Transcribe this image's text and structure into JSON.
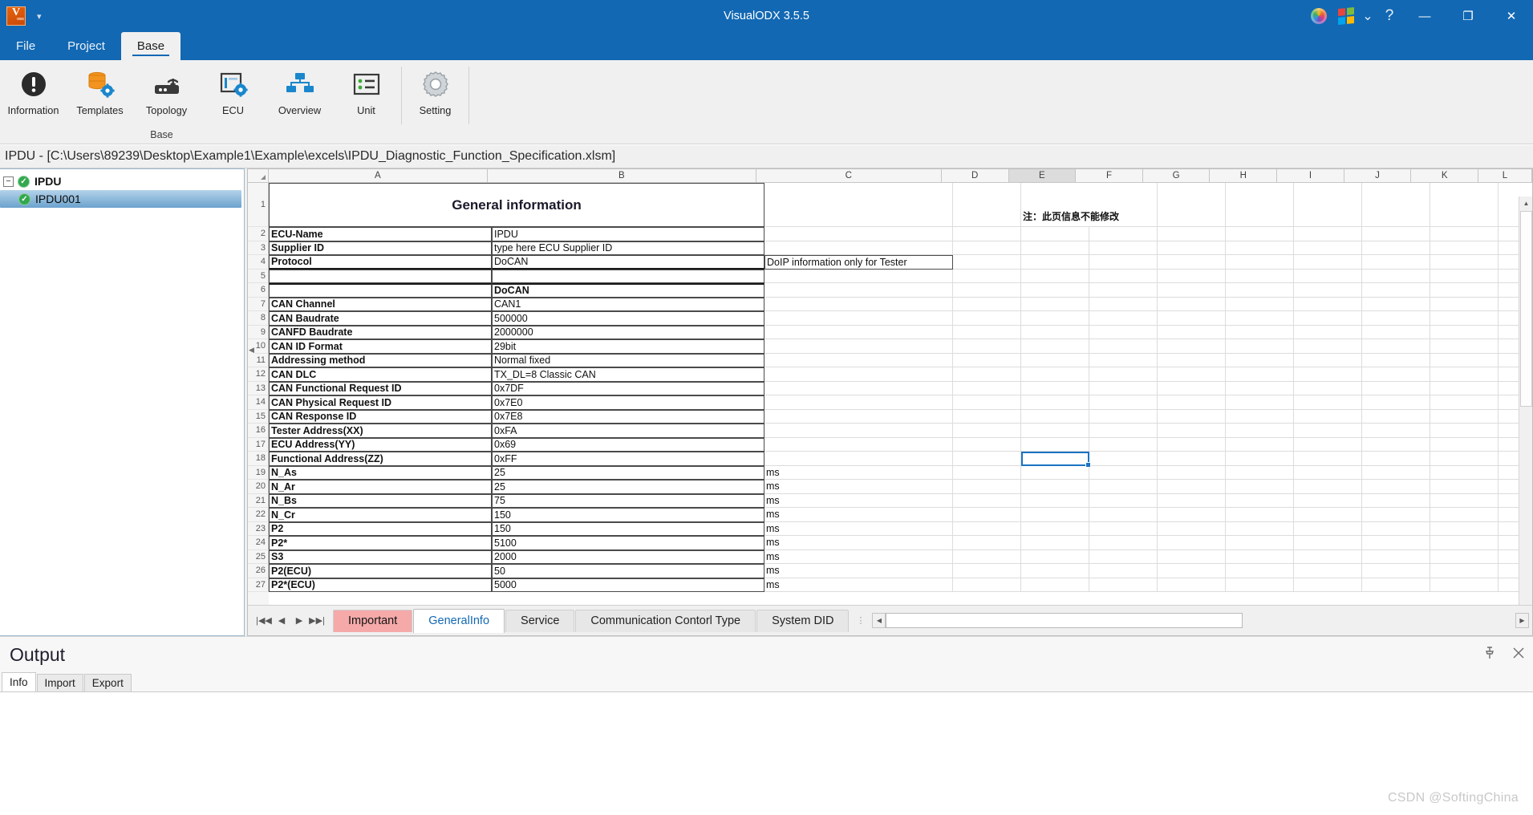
{
  "titlebar": {
    "app_title": "VisualODX 3.5.5",
    "logo_text": "V",
    "logo_sub": "ODX",
    "quick_caret": "▾",
    "icons": {
      "theme": "color-wheel-icon",
      "windows": "windows-logo-icon",
      "windows_caret": "⌄",
      "help": "?"
    },
    "window_buttons": {
      "minimize": "—",
      "maximize": "❐",
      "close": "✕"
    }
  },
  "ribbon": {
    "tabs": [
      {
        "label": "File",
        "active": false
      },
      {
        "label": "Project",
        "active": false
      },
      {
        "label": "Base",
        "active": true
      }
    ],
    "groups": [
      {
        "label": "Base",
        "buttons": [
          {
            "label": "Information",
            "icon": "information-icon"
          },
          {
            "label": "Templates",
            "icon": "database-gear-icon"
          },
          {
            "label": "Topology",
            "icon": "router-icon"
          },
          {
            "label": "ECU",
            "icon": "ecu-gear-icon"
          },
          {
            "label": "Overview",
            "icon": "hierarchy-icon"
          },
          {
            "label": "Unit",
            "icon": "list-icon"
          }
        ]
      },
      {
        "label": "",
        "buttons": [
          {
            "label": "Setting",
            "icon": "gear-icon"
          }
        ]
      }
    ]
  },
  "docpath": {
    "text": "IPDU - [C:\\Users\\89239\\Desktop\\Example1\\Example\\excels\\IPDU_Diagnostic_Function_Specification.xlsm]"
  },
  "tree": {
    "root": {
      "label": "IPDU",
      "expander": "−",
      "status": "✓"
    },
    "children": [
      {
        "label": "IPDU001",
        "status": "✓",
        "selected": true
      }
    ]
  },
  "sheet": {
    "columns": [
      "A",
      "B",
      "C",
      "D",
      "E",
      "F",
      "G",
      "H",
      "I",
      "J",
      "K",
      "L"
    ],
    "selected_column": "E",
    "selected_cell": "E18",
    "rows": [
      {
        "n": "1",
        "a": "General information",
        "b": "",
        "c": "",
        "d": "",
        "e": "",
        "note": "注：此页信息不能修改"
      },
      {
        "n": "2",
        "a": "ECU-Name",
        "b": "IPDU",
        "c": ""
      },
      {
        "n": "3",
        "a": "Supplier ID",
        "b": "type here ECU Supplier ID",
        "c": ""
      },
      {
        "n": "4",
        "a": "Protocol",
        "b": "DoCAN",
        "c": "DoIP information only for Tester"
      },
      {
        "n": "5",
        "a": "",
        "b": "",
        "c": ""
      },
      {
        "n": "6",
        "a": "",
        "b": "DoCAN",
        "c": ""
      },
      {
        "n": "7",
        "a": "CAN Channel",
        "b": "CAN1",
        "c": ""
      },
      {
        "n": "8",
        "a": "CAN Baudrate",
        "b": "500000",
        "c": ""
      },
      {
        "n": "9",
        "a": "CANFD Baudrate",
        "b": "2000000",
        "c": ""
      },
      {
        "n": "10",
        "a": "CAN ID Format",
        "b": "29bit",
        "c": ""
      },
      {
        "n": "11",
        "a": "Addressing method",
        "b": "Normal fixed",
        "c": ""
      },
      {
        "n": "12",
        "a": "CAN DLC",
        "b": "TX_DL=8 Classic CAN",
        "c": ""
      },
      {
        "n": "13",
        "a": "CAN Functional Request ID",
        "b": "0x7DF",
        "c": ""
      },
      {
        "n": "14",
        "a": "CAN Physical Request ID",
        "b": "0x7E0",
        "c": ""
      },
      {
        "n": "15",
        "a": "CAN Response ID",
        "b": "0x7E8",
        "c": ""
      },
      {
        "n": "16",
        "a": "Tester Address(XX)",
        "b": "0xFA",
        "c": ""
      },
      {
        "n": "17",
        "a": "ECU Address(YY)",
        "b": "0x69",
        "c": ""
      },
      {
        "n": "18",
        "a": "Functional Address(ZZ)",
        "b": "0xFF",
        "c": ""
      },
      {
        "n": "19",
        "a": "N_As",
        "b": "25",
        "c": "ms"
      },
      {
        "n": "20",
        "a": "N_Ar",
        "b": "25",
        "c": "ms"
      },
      {
        "n": "21",
        "a": "N_Bs",
        "b": "75",
        "c": "ms"
      },
      {
        "n": "22",
        "a": "N_Cr",
        "b": "150",
        "c": "ms"
      },
      {
        "n": "23",
        "a": "P2",
        "b": "150",
        "c": "ms"
      },
      {
        "n": "24",
        "a": "P2*",
        "b": "5100",
        "c": "ms"
      },
      {
        "n": "25",
        "a": "S3",
        "b": "2000",
        "c": "ms"
      },
      {
        "n": "26",
        "a": "P2(ECU)",
        "b": "50",
        "c": "ms"
      },
      {
        "n": "27",
        "a": "P2*(ECU)",
        "b": "5000",
        "c": "ms"
      }
    ],
    "tabs": [
      {
        "label": "Important",
        "style": "important"
      },
      {
        "label": "GeneralInfo",
        "style": "active"
      },
      {
        "label": "Service",
        "style": "normal"
      },
      {
        "label": "Communication Contorl Type",
        "style": "normal"
      },
      {
        "label": "System DID",
        "style": "normal"
      }
    ],
    "nav": {
      "first": "|◀◀",
      "prev": "◀",
      "next": "▶",
      "last": "▶▶|"
    },
    "hscroll": {
      "left": "◀",
      "right": "▶"
    },
    "vscroll": {
      "up": "▲",
      "down": "▼"
    },
    "collapse_arrow": "◀"
  },
  "output": {
    "title": "Output",
    "pin_icon": "pin-icon",
    "close_icon": "close-icon",
    "tabs": [
      {
        "label": "Info",
        "active": true
      },
      {
        "label": "Import",
        "active": false
      },
      {
        "label": "Export",
        "active": false
      }
    ],
    "content": ""
  },
  "watermark": {
    "text": "CSDN @SoftingChina"
  },
  "colors": {
    "titlebar": "#1268b3",
    "accent": "#1268b3",
    "important_tab": "#f5a9a9",
    "selection": "#1a73c4",
    "tree_selected": "#6ba2cd"
  }
}
